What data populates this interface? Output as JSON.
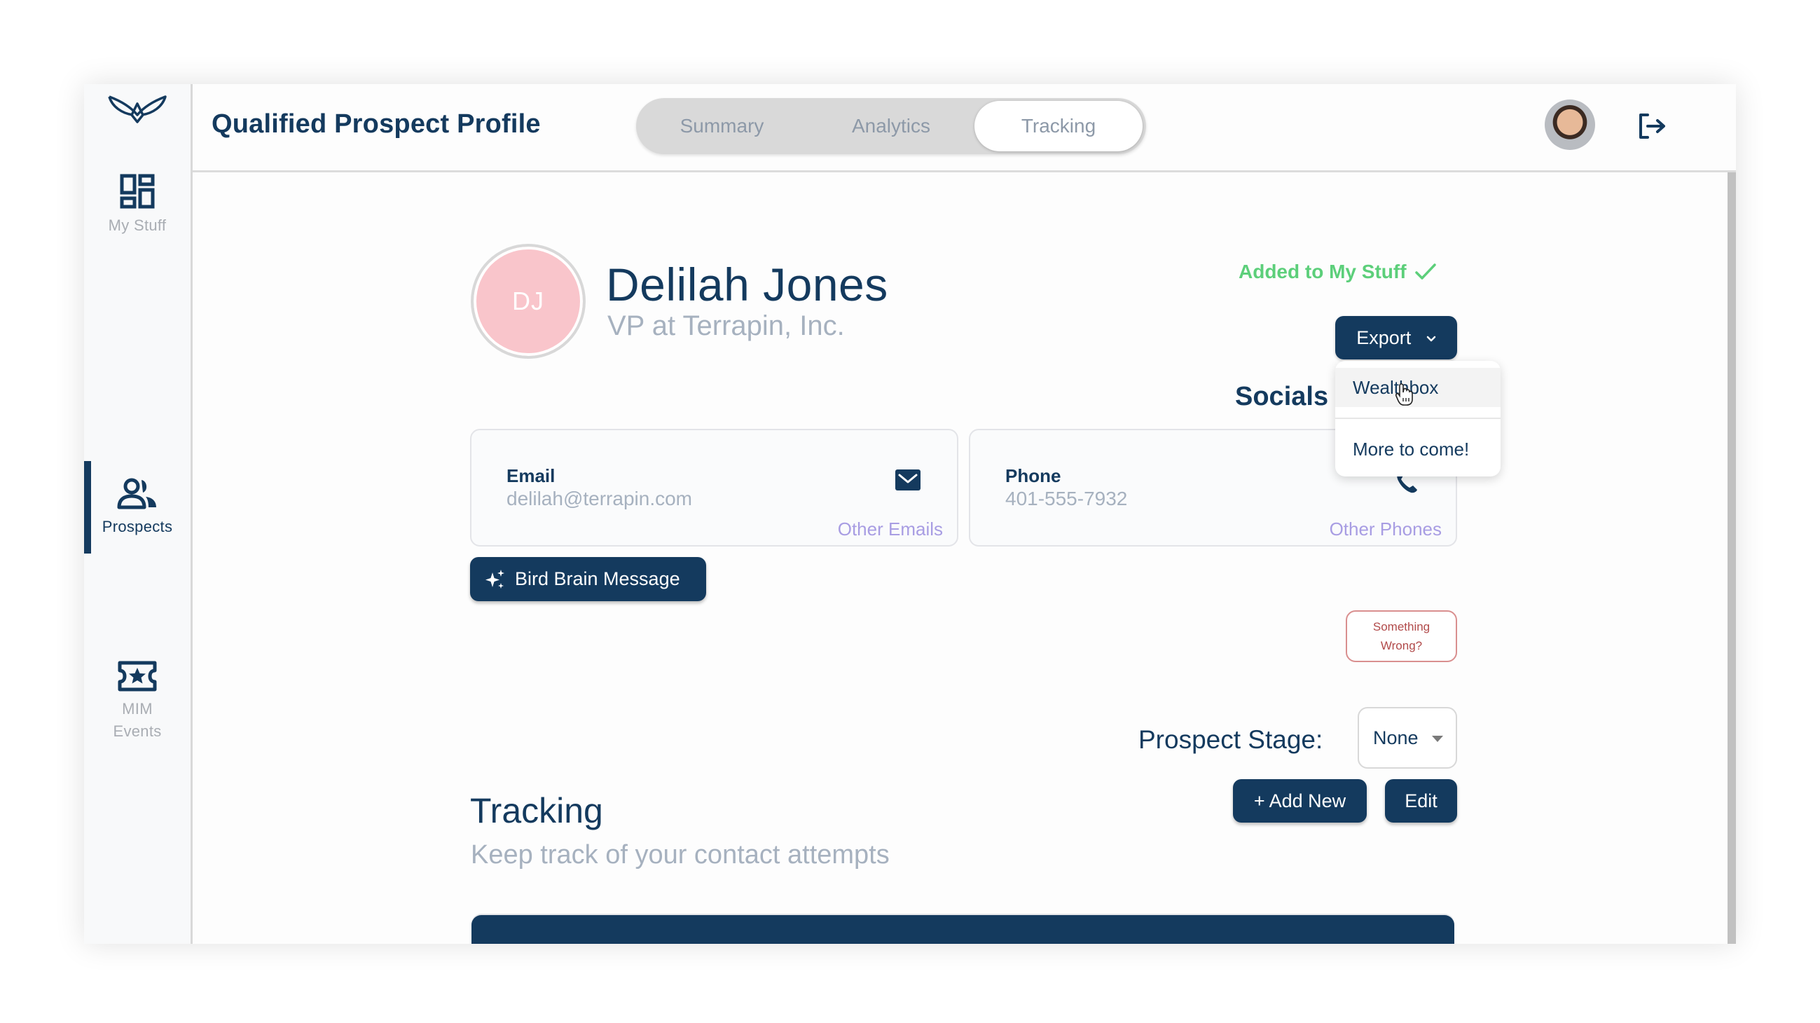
{
  "app": {
    "page_title": "Qualified Prospect Profile"
  },
  "tabs": [
    {
      "label": "Summary",
      "active": false
    },
    {
      "label": "Analytics",
      "active": false
    },
    {
      "label": "Tracking",
      "active": true
    }
  ],
  "sidebar": {
    "items": [
      {
        "label": "My Stuff",
        "icon": "dashboard-icon",
        "active": false
      },
      {
        "label": "Prospects",
        "icon": "people-icon",
        "active": true
      },
      {
        "label_line1": "MIM",
        "label_line2": "Events",
        "icon": "ticket-star-icon",
        "active": false
      }
    ]
  },
  "header": {
    "user_avatar": "user-avatar-photo",
    "logout_icon": "logout-icon"
  },
  "prospect": {
    "initials": "DJ",
    "name": "Delilah Jones",
    "subtitle": "VP at Terrapin, Inc.",
    "status": "Added to My Stuff",
    "avatar_color": "#f9c5cb"
  },
  "export": {
    "label": "Export",
    "menu": [
      {
        "label": "Wealthbox",
        "hovered": true
      },
      {
        "label": "More to come!",
        "hovered": false
      }
    ]
  },
  "socials": {
    "title": "Socials"
  },
  "contact_cards": {
    "email": {
      "label": "Email",
      "value": "delilah@terrapin.com",
      "link": "Other Emails"
    },
    "phone": {
      "label": "Phone",
      "value": "401-555-7932",
      "link": "Other Phones"
    }
  },
  "actions": {
    "bird_brain": "Bird Brain Message",
    "something_wrong_line1": "Something",
    "something_wrong_line2": "Wrong?"
  },
  "stage": {
    "label": "Prospect Stage:",
    "selected": "None"
  },
  "tracking": {
    "title": "Tracking",
    "subtitle": "Keep track of your contact attempts",
    "add_label": "+ Add New",
    "edit_label": "Edit"
  },
  "colors": {
    "primary": "#143a5e",
    "success": "#5ccf7a",
    "link": "#a89de3",
    "muted": "#a6b1bf",
    "danger": "#b14a4a"
  }
}
